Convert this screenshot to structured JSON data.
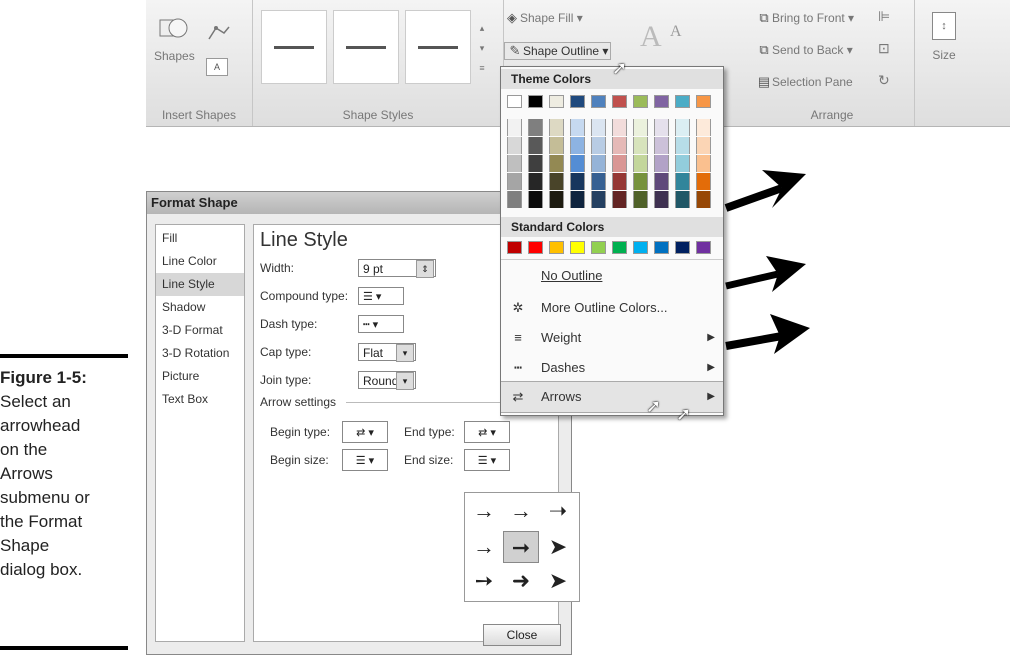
{
  "caption": {
    "figure_label": "Figure 1-5:",
    "text_lines": [
      "Select an",
      "arrowhead",
      "on the",
      "Arrows",
      "submenu or",
      "the Format",
      "Shape",
      "dialog box."
    ]
  },
  "ribbon": {
    "groups": {
      "insert_shapes": "Insert Shapes",
      "shape_styles": "Shape Styles",
      "arrange": "Arrange"
    },
    "shapes_label": "Shapes",
    "shape_fill_label": "Shape Fill",
    "shape_outline_label": "Shape Outline",
    "bring_to_front_label": "Bring to Front",
    "send_to_back_label": "Send to Back",
    "selection_pane_label": "Selection Pane",
    "size_label": "Size"
  },
  "outline_menu": {
    "theme_header": "Theme Colors",
    "standard_header": "Standard Colors",
    "theme_top_colors": [
      "#ffffff",
      "#000000",
      "#eeece1",
      "#1f497d",
      "#4f81bd",
      "#c0504d",
      "#9bbb59",
      "#8064a2",
      "#4bacc6",
      "#f79646"
    ],
    "theme_columns_shades": [
      [
        "#f2f2f2",
        "#d8d8d8",
        "#bfbfbf",
        "#a5a5a5",
        "#7f7f7f"
      ],
      [
        "#7f7f7f",
        "#595959",
        "#3f3f3f",
        "#262626",
        "#0c0c0c"
      ],
      [
        "#ddd9c3",
        "#c4bd97",
        "#938953",
        "#494429",
        "#1d1b10"
      ],
      [
        "#c6d9f0",
        "#8db3e2",
        "#548dd4",
        "#17365d",
        "#0f243e"
      ],
      [
        "#dbe5f1",
        "#b8cce4",
        "#95b3d7",
        "#366092",
        "#244061"
      ],
      [
        "#f2dcdb",
        "#e5b9b7",
        "#d99694",
        "#953734",
        "#632423"
      ],
      [
        "#ebf1dd",
        "#d7e3bc",
        "#c3d69b",
        "#76923c",
        "#4f6128"
      ],
      [
        "#e5e0ec",
        "#ccc1d9",
        "#b2a2c7",
        "#5f497a",
        "#3f3151"
      ],
      [
        "#dbeef3",
        "#b7dde8",
        "#92cddc",
        "#31859b",
        "#205867"
      ],
      [
        "#fdeada",
        "#fbd5b5",
        "#fac08f",
        "#e36c09",
        "#974806"
      ]
    ],
    "standard_colors": [
      "#c00000",
      "#ff0000",
      "#ffc000",
      "#ffff00",
      "#92d050",
      "#00b050",
      "#00b0f0",
      "#0070c0",
      "#002060",
      "#7030a0"
    ],
    "items": {
      "no_outline": "No Outline",
      "more_colors": "More Outline Colors...",
      "weight": "Weight",
      "dashes": "Dashes",
      "arrows": "Arrows"
    }
  },
  "dialog": {
    "title": "Format Shape",
    "nav": [
      "Fill",
      "Line Color",
      "Line Style",
      "Shadow",
      "3-D Format",
      "3-D Rotation",
      "Picture",
      "Text Box"
    ],
    "active_nav": "Line Style",
    "heading": "Line Style",
    "width_label": "Width:",
    "width_value": "9 pt",
    "compound_label": "Compound type:",
    "dash_label": "Dash type:",
    "cap_label": "Cap type:",
    "cap_value": "Flat",
    "join_label": "Join type:",
    "join_value": "Round",
    "arrow_settings_label": "Arrow settings",
    "begin_type_label": "Begin type:",
    "end_type_label": "End type:",
    "begin_size_label": "Begin size:",
    "end_size_label": "End size:",
    "close_label": "Close"
  }
}
